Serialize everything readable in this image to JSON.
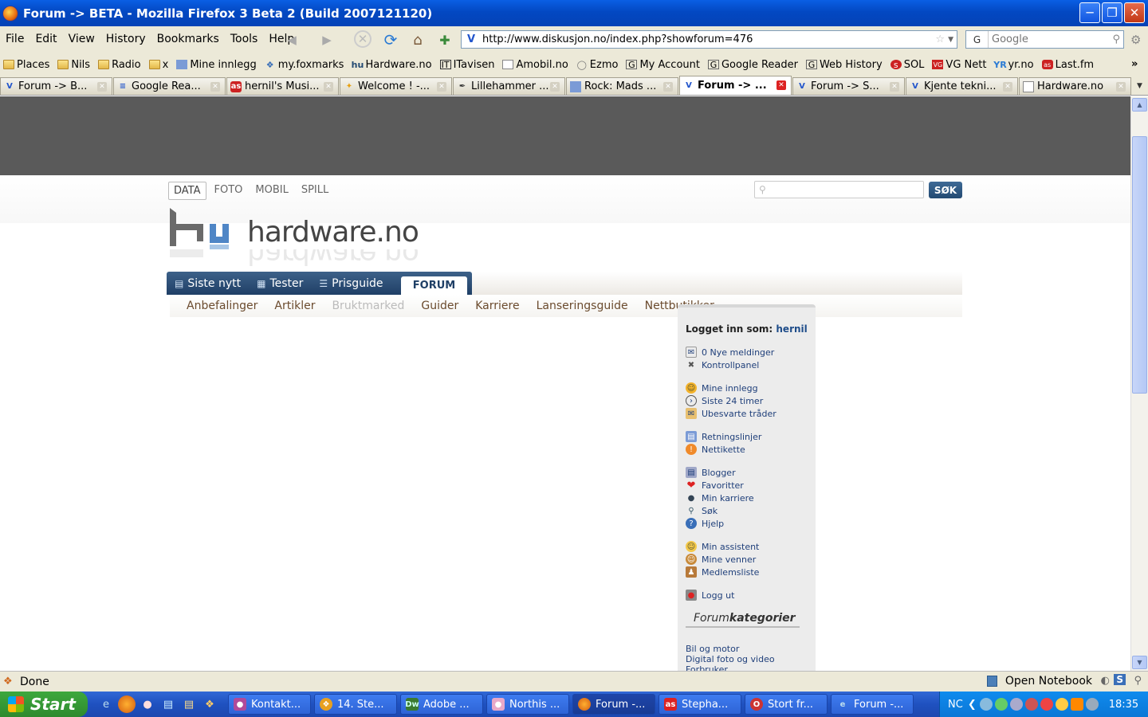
{
  "window": {
    "title": "Forum -> BETA - Mozilla Firefox 3 Beta 2 (Build 2007121120)"
  },
  "menu": [
    "File",
    "Edit",
    "View",
    "History",
    "Bookmarks",
    "Tools",
    "Help"
  ],
  "urlbar": {
    "value": "http://www.diskusjon.no/index.php?showforum=476"
  },
  "search": {
    "engine": "G",
    "placeholder": "Google"
  },
  "bookmarks": [
    "Places",
    "Nils",
    "Radio",
    "x",
    "Mine innlegg",
    "my.foxmarks",
    "Hardware.no",
    "ITavisen",
    "Amobil.no",
    "Ezmo",
    "My Account",
    "Google Reader",
    "Web History",
    "SOL",
    "VG Nett",
    "yr.no",
    "Last.fm"
  ],
  "tabs": [
    {
      "label": "Forum -> B..."
    },
    {
      "label": "Google Rea..."
    },
    {
      "label": "hernil's Musi..."
    },
    {
      "label": "Welcome ! -..."
    },
    {
      "label": "Lillehammer ..."
    },
    {
      "label": "Rock: Mads ..."
    },
    {
      "label": "Forum -> ..."
    },
    {
      "label": "Forum -> S..."
    },
    {
      "label": "Kjente tekni..."
    },
    {
      "label": "Hardware.no"
    }
  ],
  "site": {
    "topnav": [
      "DATA",
      "FOTO",
      "MOBIL",
      "SPILL"
    ],
    "search_button": "SØK",
    "logo_text": "hardware.no",
    "maintabs": [
      "Siste nytt",
      "Tester",
      "Prisguide"
    ],
    "forum_tab": "FORUM",
    "subnav": [
      "Anbefalinger",
      "Artikler",
      "Bruktmarked",
      "Guider",
      "Karriere",
      "Lanseringsguide",
      "Nettbutikker"
    ]
  },
  "sidebar": {
    "login_label": "Logget inn som:",
    "username": "hernil",
    "groups": [
      [
        "0 Nye meldinger",
        "Kontrollpanel"
      ],
      [
        "Mine innlegg",
        "Siste 24 timer",
        "Ubesvarte tråder"
      ],
      [
        "Retningslinjer",
        "Nettikette"
      ],
      [
        "Blogger",
        "Favoritter",
        "Min karriere",
        "Søk",
        "Hjelp"
      ],
      [
        "Min assistent",
        "Mine venner",
        "Medlemsliste"
      ],
      [
        "Logg ut"
      ]
    ],
    "categories_title_a": "Forum",
    "categories_title_b": "kategorier",
    "categories": [
      "Bil og motor",
      "Digital foto og video",
      "Forbruker"
    ]
  },
  "status": {
    "text": "Done",
    "notebook": "Open Notebook"
  },
  "taskbar": {
    "start": "Start",
    "items": [
      "Kontakt...",
      "14. Ste...",
      "Adobe ...",
      "Northis ...",
      "Forum -...",
      "Stepha...",
      "Stort fr...",
      "Forum -..."
    ],
    "tray_label": "NC",
    "clock": "18:35"
  }
}
